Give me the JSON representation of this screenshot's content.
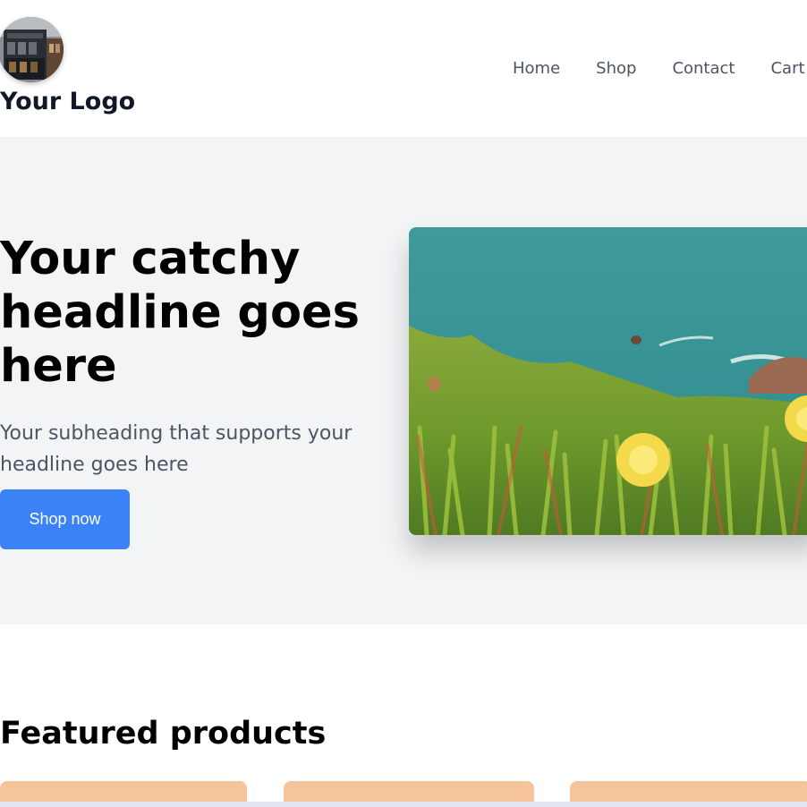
{
  "header": {
    "logo_text": "Your Logo",
    "nav": [
      "Home",
      "Shop",
      "Contact",
      "Cart"
    ]
  },
  "hero": {
    "headline": "Your catchy headline goes here",
    "subheading": "Your subheading that supports your headline goes here",
    "cta_label": "Shop now",
    "cta_color": "#3b82f6",
    "background": "#f2f4f6"
  },
  "featured": {
    "title": "Featured products",
    "card_color": "#f6c49a"
  }
}
